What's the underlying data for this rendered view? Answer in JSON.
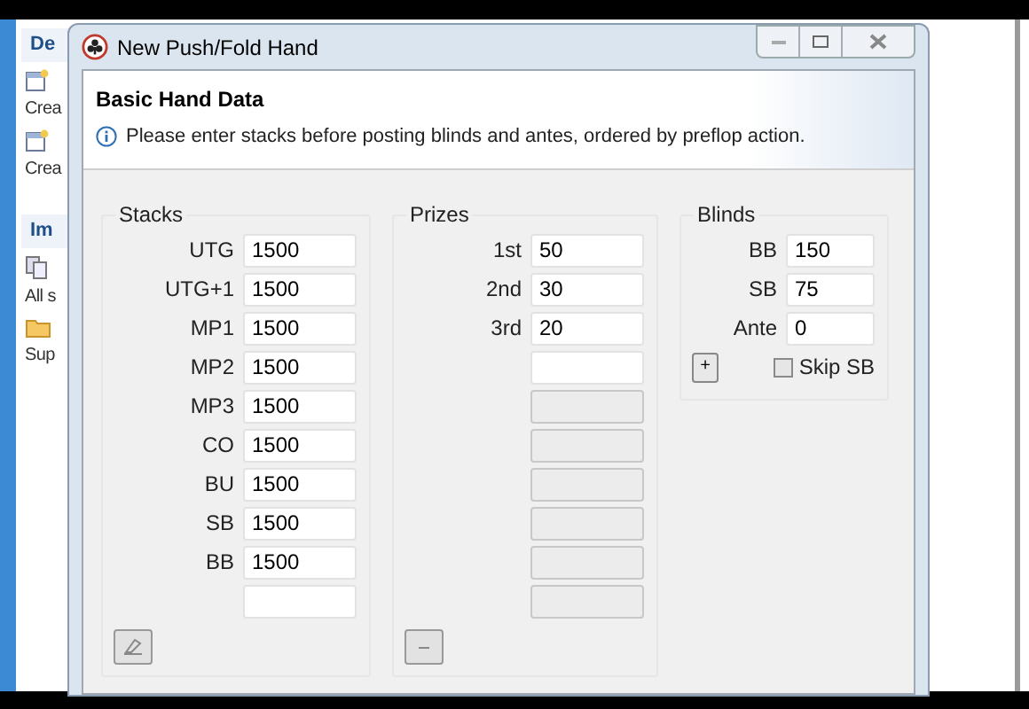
{
  "background_panel": {
    "sections": [
      {
        "title": "De",
        "items": [
          {
            "kind": "file",
            "label": "Crea"
          },
          {
            "kind": "file",
            "label": "Crea"
          }
        ]
      },
      {
        "title": "Im",
        "items": [
          {
            "kind": "copies",
            "label": "All s"
          },
          {
            "kind": "folder",
            "label": "Sup"
          }
        ]
      }
    ]
  },
  "dialog": {
    "title": "New Push/Fold Hand",
    "header": {
      "title": "Basic Hand Data",
      "info": "Please enter stacks before posting blinds and antes, ordered by preflop action."
    },
    "stacks": {
      "title": "Stacks",
      "fields": [
        {
          "label": "UTG",
          "value": "1500",
          "disabled": false
        },
        {
          "label": "UTG+1",
          "value": "1500",
          "disabled": false
        },
        {
          "label": "MP1",
          "value": "1500",
          "disabled": false
        },
        {
          "label": "MP2",
          "value": "1500",
          "disabled": false
        },
        {
          "label": "MP3",
          "value": "1500",
          "disabled": false
        },
        {
          "label": "CO",
          "value": "1500",
          "disabled": false
        },
        {
          "label": "BU",
          "value": "1500",
          "disabled": false
        },
        {
          "label": "SB",
          "value": "1500",
          "disabled": false
        },
        {
          "label": "BB",
          "value": "1500",
          "disabled": false
        },
        {
          "disabled": false
        }
      ]
    },
    "prizes": {
      "title": "Prizes",
      "fields": [
        {
          "label": "1st",
          "value": "50",
          "disabled": false
        },
        {
          "label": "2nd",
          "value": "30",
          "disabled": false
        },
        {
          "label": "3rd",
          "value": "20",
          "disabled": false
        },
        {
          "disabled": false
        },
        {
          "disabled": true
        },
        {
          "disabled": true
        },
        {
          "disabled": true
        },
        {
          "disabled": true
        },
        {
          "disabled": true
        },
        {
          "disabled": true
        }
      ]
    },
    "blinds": {
      "title": "Blinds",
      "fields": [
        {
          "label": "BB",
          "value": "150",
          "disabled": false
        },
        {
          "label": "SB",
          "value": "75",
          "disabled": false
        },
        {
          "label": "Ante",
          "value": "0",
          "disabled": false
        }
      ],
      "add_button": "+",
      "skip_sb": {
        "label": "Skip SB",
        "checked": false
      }
    }
  }
}
